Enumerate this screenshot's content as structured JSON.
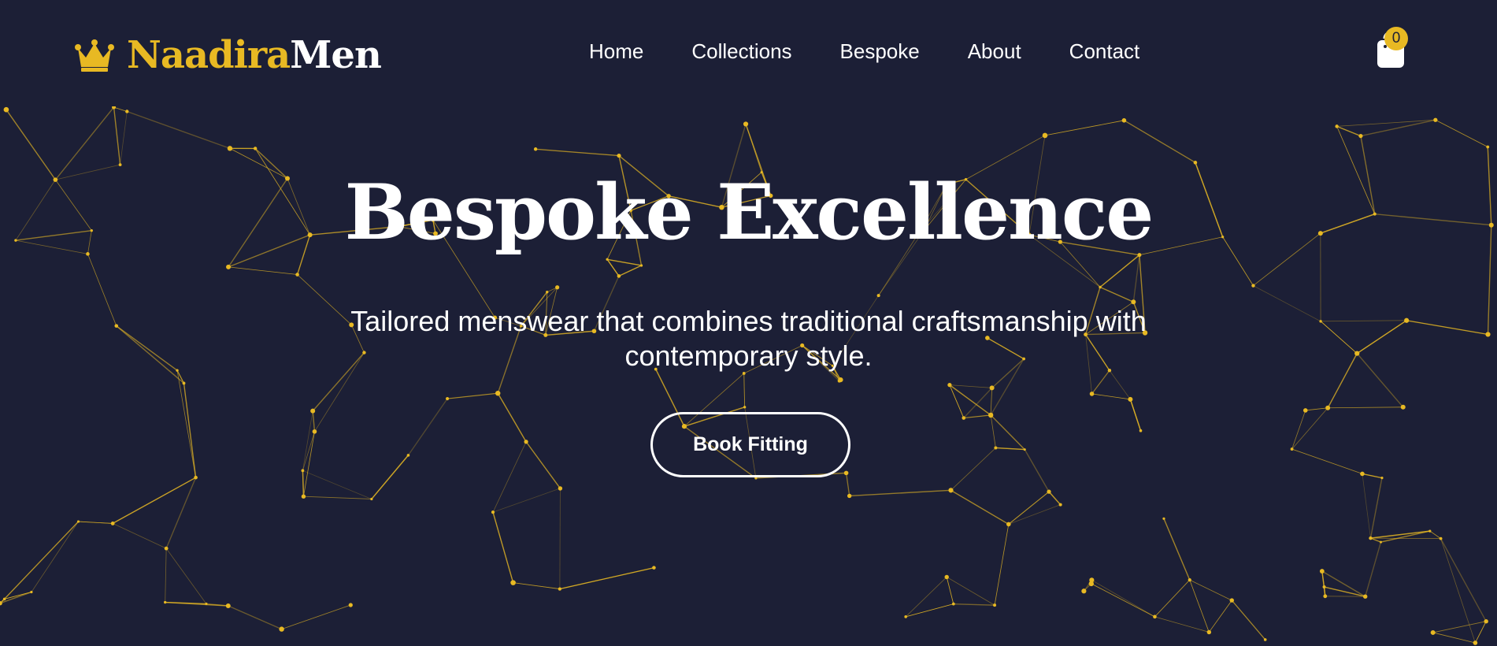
{
  "brand": {
    "name_part1": "Naadira",
    "name_part2": "Men",
    "icon": "crown-icon"
  },
  "nav": {
    "items": [
      {
        "label": "Home"
      },
      {
        "label": "Collections"
      },
      {
        "label": "Bespoke"
      },
      {
        "label": "About"
      },
      {
        "label": "Contact"
      }
    ]
  },
  "cart": {
    "icon": "shopping-bag-icon",
    "count": "0"
  },
  "hero": {
    "title": "Bespoke Excellence",
    "subtitle": "Tailored menswear that combines traditional craftsmanship with contemporary style.",
    "cta_label": "Book Fitting"
  },
  "colors": {
    "background": "#1c1f36",
    "accent": "#e8b923",
    "text": "#ffffff"
  }
}
